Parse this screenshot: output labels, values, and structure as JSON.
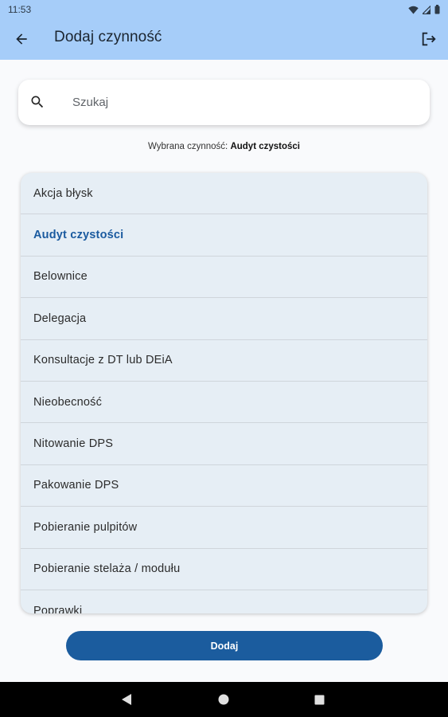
{
  "status_bar": {
    "time": "11:53",
    "icons": [
      "wifi-icon",
      "signal-icon",
      "battery-icon"
    ]
  },
  "app_bar": {
    "title": "Dodaj czynność",
    "back_icon": "arrow-back-icon",
    "logout_icon": "logout-icon"
  },
  "search": {
    "placeholder": "Szukaj",
    "value": "",
    "icon": "search-icon"
  },
  "selected": {
    "label": "Wybrana czynność:",
    "value": "Audyt czystości"
  },
  "activities": [
    {
      "label": "Akcja błysk",
      "selected": false
    },
    {
      "label": "Audyt czystości",
      "selected": true
    },
    {
      "label": "Belownice",
      "selected": false
    },
    {
      "label": "Delegacja",
      "selected": false
    },
    {
      "label": "Konsultacje z DT lub DEiA",
      "selected": false
    },
    {
      "label": "Nieobecność",
      "selected": false
    },
    {
      "label": "Nitowanie DPS",
      "selected": false
    },
    {
      "label": "Pakowanie DPS",
      "selected": false
    },
    {
      "label": "Pobieranie pulpitów",
      "selected": false
    },
    {
      "label": "Pobieranie stelaża / modułu",
      "selected": false
    },
    {
      "label": "Poprawki",
      "selected": false
    }
  ],
  "actions": {
    "add_label": "Dodaj"
  },
  "colors": {
    "app_bar": "#a6cdf9",
    "accent": "#1b5c9e",
    "list_bg": "#e6eef5",
    "selected_text": "#1a5a9f"
  }
}
